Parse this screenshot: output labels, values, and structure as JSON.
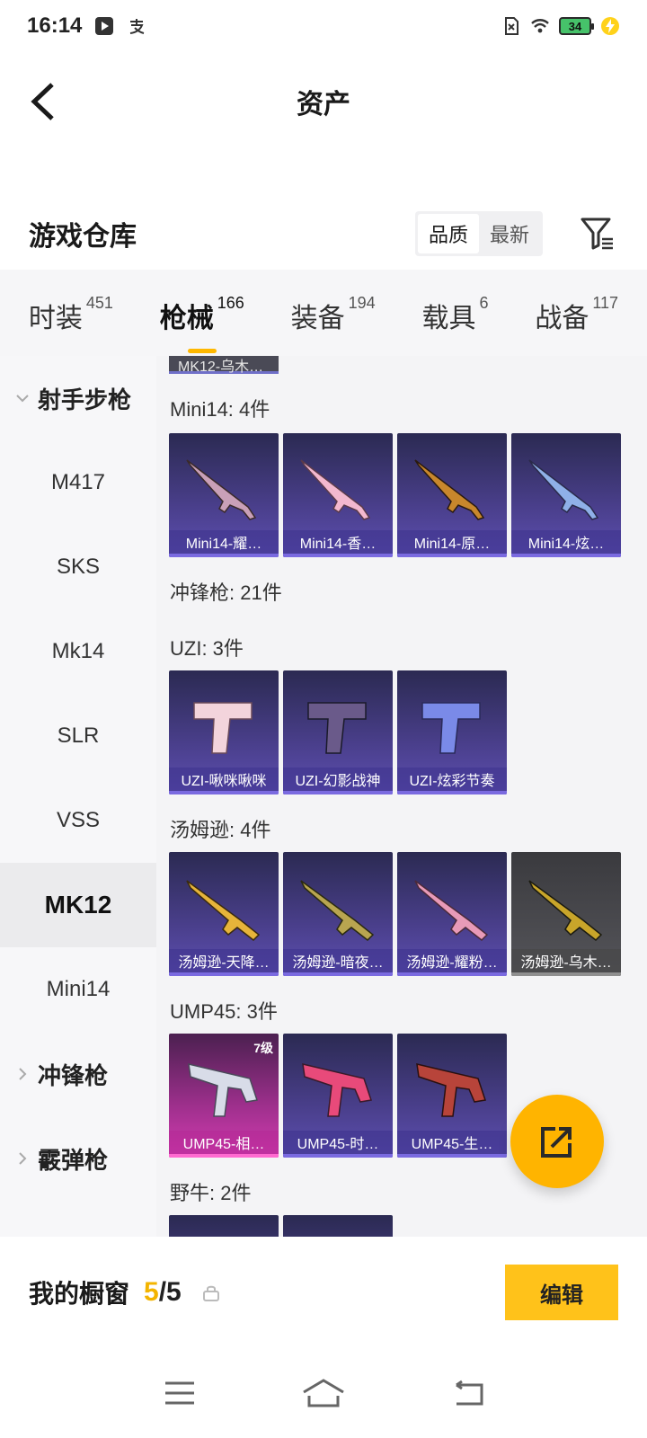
{
  "status_bar": {
    "time": "16:14",
    "battery": "34"
  },
  "header": {
    "title": "资产"
  },
  "warehouse": {
    "title": "游戏仓库",
    "sort_options": [
      "品质",
      "最新"
    ]
  },
  "category_tabs": [
    {
      "label": "时装",
      "count": "451"
    },
    {
      "label": "枪械",
      "count": "166"
    },
    {
      "label": "装备",
      "count": "194"
    },
    {
      "label": "载具",
      "count": "6"
    },
    {
      "label": "战备",
      "count": "117"
    }
  ],
  "sidebar": {
    "group_rifle": "射手步枪",
    "items": [
      "M417",
      "SKS",
      "Mk14",
      "SLR",
      "VSS",
      "MK12",
      "Mini14"
    ],
    "group_smg": "冲锋枪",
    "group_shotgun": "霰弹枪"
  },
  "content": {
    "partial_item": "MK12-乌木…",
    "mini14": {
      "title": "Mini14: 4件",
      "cards": [
        "Mini14-耀…",
        "Mini14-香…",
        "Mini14-原…",
        "Mini14-炫…"
      ]
    },
    "smg_title": "冲锋枪: 21件",
    "uzi": {
      "title": "UZI: 3件",
      "cards": [
        "UZI-啾咪啾咪",
        "UZI-幻影战神",
        "UZI-炫彩节奏"
      ]
    },
    "thompson": {
      "title": "汤姆逊: 4件",
      "cards": [
        "汤姆逊-天降…",
        "汤姆逊-暗夜…",
        "汤姆逊-耀粉…",
        "汤姆逊-乌木…"
      ]
    },
    "ump45": {
      "title": "UMP45: 3件",
      "level_badge": "7级",
      "cards": [
        "UMP45-相…",
        "UMP45-时…",
        "UMP45-生…"
      ]
    },
    "bizon_title": "野牛: 2件"
  },
  "bottom_bar": {
    "showcase_label": "我的橱窗",
    "used": "5",
    "slash_total": "/5",
    "edit_label": "编辑"
  },
  "colors": {
    "accent": "#ffb800",
    "card_purple": "#4a3f8c"
  }
}
